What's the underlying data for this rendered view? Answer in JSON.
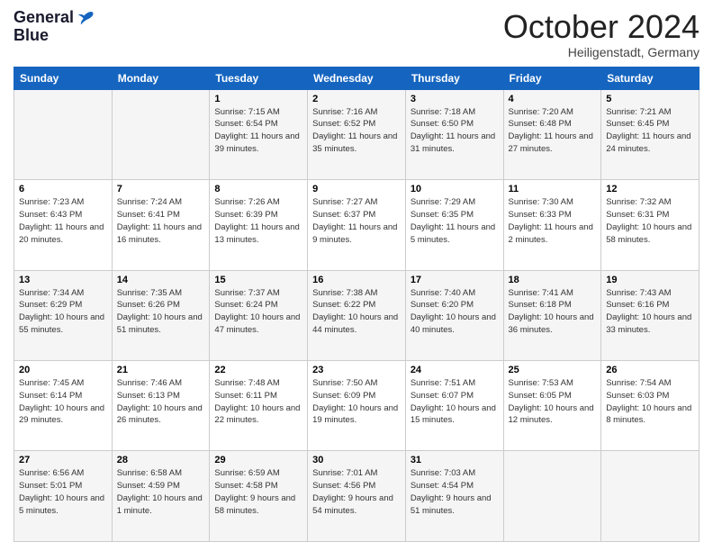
{
  "header": {
    "logo": {
      "general": "General",
      "blue": "Blue"
    },
    "title": "October 2024",
    "location": "Heiligenstadt, Germany"
  },
  "days_of_week": [
    "Sunday",
    "Monday",
    "Tuesday",
    "Wednesday",
    "Thursday",
    "Friday",
    "Saturday"
  ],
  "weeks": [
    [
      {
        "day": "",
        "sunrise": "",
        "sunset": "",
        "daylight": ""
      },
      {
        "day": "",
        "sunrise": "",
        "sunset": "",
        "daylight": ""
      },
      {
        "day": "1",
        "sunrise": "Sunrise: 7:15 AM",
        "sunset": "Sunset: 6:54 PM",
        "daylight": "Daylight: 11 hours and 39 minutes."
      },
      {
        "day": "2",
        "sunrise": "Sunrise: 7:16 AM",
        "sunset": "Sunset: 6:52 PM",
        "daylight": "Daylight: 11 hours and 35 minutes."
      },
      {
        "day": "3",
        "sunrise": "Sunrise: 7:18 AM",
        "sunset": "Sunset: 6:50 PM",
        "daylight": "Daylight: 11 hours and 31 minutes."
      },
      {
        "day": "4",
        "sunrise": "Sunrise: 7:20 AM",
        "sunset": "Sunset: 6:48 PM",
        "daylight": "Daylight: 11 hours and 27 minutes."
      },
      {
        "day": "5",
        "sunrise": "Sunrise: 7:21 AM",
        "sunset": "Sunset: 6:45 PM",
        "daylight": "Daylight: 11 hours and 24 minutes."
      }
    ],
    [
      {
        "day": "6",
        "sunrise": "Sunrise: 7:23 AM",
        "sunset": "Sunset: 6:43 PM",
        "daylight": "Daylight: 11 hours and 20 minutes."
      },
      {
        "day": "7",
        "sunrise": "Sunrise: 7:24 AM",
        "sunset": "Sunset: 6:41 PM",
        "daylight": "Daylight: 11 hours and 16 minutes."
      },
      {
        "day": "8",
        "sunrise": "Sunrise: 7:26 AM",
        "sunset": "Sunset: 6:39 PM",
        "daylight": "Daylight: 11 hours and 13 minutes."
      },
      {
        "day": "9",
        "sunrise": "Sunrise: 7:27 AM",
        "sunset": "Sunset: 6:37 PM",
        "daylight": "Daylight: 11 hours and 9 minutes."
      },
      {
        "day": "10",
        "sunrise": "Sunrise: 7:29 AM",
        "sunset": "Sunset: 6:35 PM",
        "daylight": "Daylight: 11 hours and 5 minutes."
      },
      {
        "day": "11",
        "sunrise": "Sunrise: 7:30 AM",
        "sunset": "Sunset: 6:33 PM",
        "daylight": "Daylight: 11 hours and 2 minutes."
      },
      {
        "day": "12",
        "sunrise": "Sunrise: 7:32 AM",
        "sunset": "Sunset: 6:31 PM",
        "daylight": "Daylight: 10 hours and 58 minutes."
      }
    ],
    [
      {
        "day": "13",
        "sunrise": "Sunrise: 7:34 AM",
        "sunset": "Sunset: 6:29 PM",
        "daylight": "Daylight: 10 hours and 55 minutes."
      },
      {
        "day": "14",
        "sunrise": "Sunrise: 7:35 AM",
        "sunset": "Sunset: 6:26 PM",
        "daylight": "Daylight: 10 hours and 51 minutes."
      },
      {
        "day": "15",
        "sunrise": "Sunrise: 7:37 AM",
        "sunset": "Sunset: 6:24 PM",
        "daylight": "Daylight: 10 hours and 47 minutes."
      },
      {
        "day": "16",
        "sunrise": "Sunrise: 7:38 AM",
        "sunset": "Sunset: 6:22 PM",
        "daylight": "Daylight: 10 hours and 44 minutes."
      },
      {
        "day": "17",
        "sunrise": "Sunrise: 7:40 AM",
        "sunset": "Sunset: 6:20 PM",
        "daylight": "Daylight: 10 hours and 40 minutes."
      },
      {
        "day": "18",
        "sunrise": "Sunrise: 7:41 AM",
        "sunset": "Sunset: 6:18 PM",
        "daylight": "Daylight: 10 hours and 36 minutes."
      },
      {
        "day": "19",
        "sunrise": "Sunrise: 7:43 AM",
        "sunset": "Sunset: 6:16 PM",
        "daylight": "Daylight: 10 hours and 33 minutes."
      }
    ],
    [
      {
        "day": "20",
        "sunrise": "Sunrise: 7:45 AM",
        "sunset": "Sunset: 6:14 PM",
        "daylight": "Daylight: 10 hours and 29 minutes."
      },
      {
        "day": "21",
        "sunrise": "Sunrise: 7:46 AM",
        "sunset": "Sunset: 6:13 PM",
        "daylight": "Daylight: 10 hours and 26 minutes."
      },
      {
        "day": "22",
        "sunrise": "Sunrise: 7:48 AM",
        "sunset": "Sunset: 6:11 PM",
        "daylight": "Daylight: 10 hours and 22 minutes."
      },
      {
        "day": "23",
        "sunrise": "Sunrise: 7:50 AM",
        "sunset": "Sunset: 6:09 PM",
        "daylight": "Daylight: 10 hours and 19 minutes."
      },
      {
        "day": "24",
        "sunrise": "Sunrise: 7:51 AM",
        "sunset": "Sunset: 6:07 PM",
        "daylight": "Daylight: 10 hours and 15 minutes."
      },
      {
        "day": "25",
        "sunrise": "Sunrise: 7:53 AM",
        "sunset": "Sunset: 6:05 PM",
        "daylight": "Daylight: 10 hours and 12 minutes."
      },
      {
        "day": "26",
        "sunrise": "Sunrise: 7:54 AM",
        "sunset": "Sunset: 6:03 PM",
        "daylight": "Daylight: 10 hours and 8 minutes."
      }
    ],
    [
      {
        "day": "27",
        "sunrise": "Sunrise: 6:56 AM",
        "sunset": "Sunset: 5:01 PM",
        "daylight": "Daylight: 10 hours and 5 minutes."
      },
      {
        "day": "28",
        "sunrise": "Sunrise: 6:58 AM",
        "sunset": "Sunset: 4:59 PM",
        "daylight": "Daylight: 10 hours and 1 minute."
      },
      {
        "day": "29",
        "sunrise": "Sunrise: 6:59 AM",
        "sunset": "Sunset: 4:58 PM",
        "daylight": "Daylight: 9 hours and 58 minutes."
      },
      {
        "day": "30",
        "sunrise": "Sunrise: 7:01 AM",
        "sunset": "Sunset: 4:56 PM",
        "daylight": "Daylight: 9 hours and 54 minutes."
      },
      {
        "day": "31",
        "sunrise": "Sunrise: 7:03 AM",
        "sunset": "Sunset: 4:54 PM",
        "daylight": "Daylight: 9 hours and 51 minutes."
      },
      {
        "day": "",
        "sunrise": "",
        "sunset": "",
        "daylight": ""
      },
      {
        "day": "",
        "sunrise": "",
        "sunset": "",
        "daylight": ""
      }
    ]
  ]
}
